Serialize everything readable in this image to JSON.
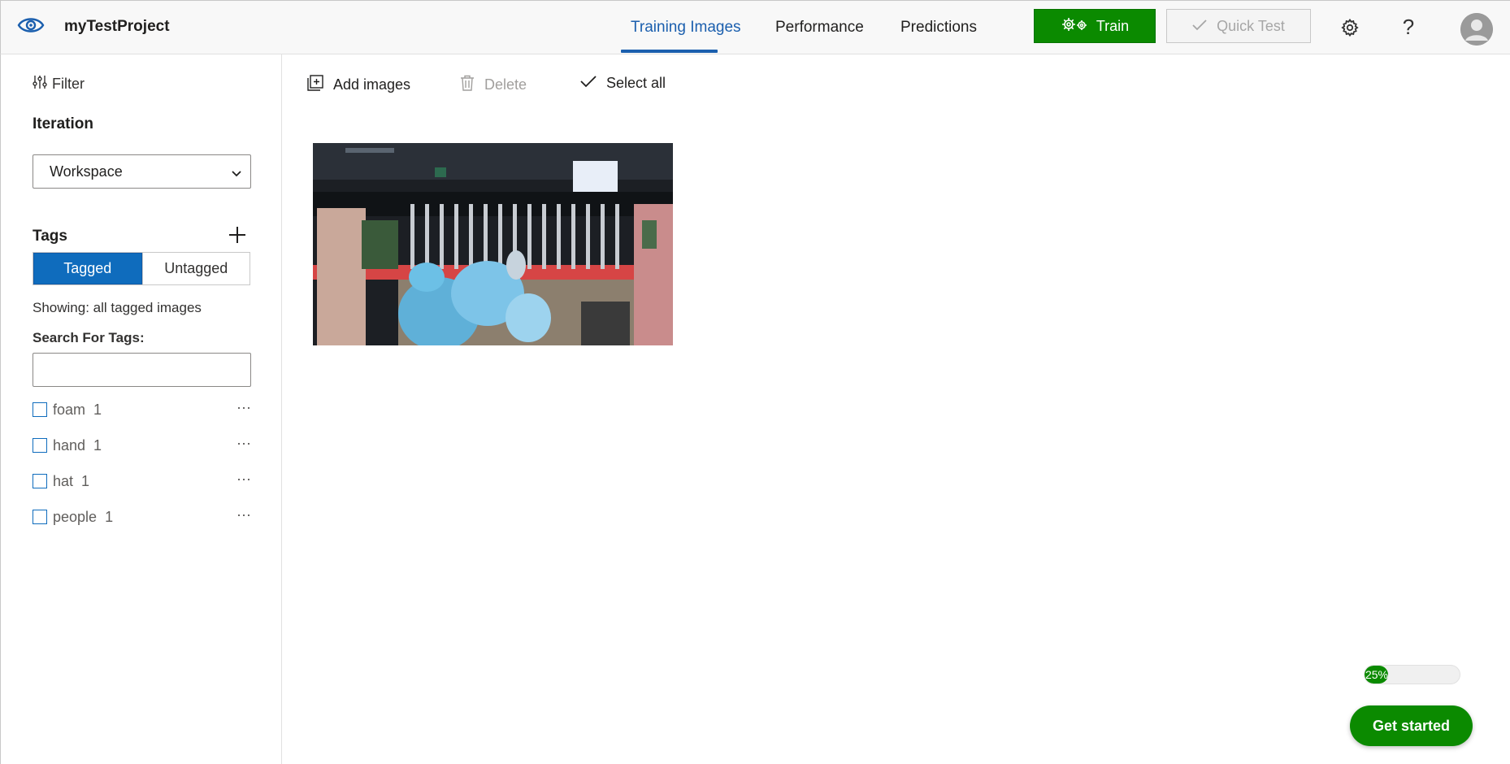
{
  "app": {
    "project_title": "myTestProject"
  },
  "nav": {
    "tabs": [
      {
        "label": "Training Images",
        "active": true
      },
      {
        "label": "Performance",
        "active": false
      },
      {
        "label": "Predictions",
        "active": false
      }
    ],
    "train_label": "Train",
    "quick_test_label": "Quick Test",
    "help_label": "?"
  },
  "sidebar": {
    "filter_label": "Filter",
    "iteration_label": "Iteration",
    "iteration_selected": "Workspace",
    "tags_label": "Tags",
    "segment": {
      "tagged": "Tagged",
      "untagged": "Untagged",
      "selected": "Tagged"
    },
    "showing_text": "Showing: all tagged images",
    "search_label": "Search For Tags:",
    "search_value": "",
    "tags": [
      {
        "name": "foam",
        "count": "1"
      },
      {
        "name": "hand",
        "count": "1"
      },
      {
        "name": "hat",
        "count": "1"
      },
      {
        "name": "people",
        "count": "1"
      }
    ]
  },
  "toolbar": {
    "add_images": "Add images",
    "delete": "Delete",
    "select_all": "Select all"
  },
  "images": {
    "count_shown": 1
  },
  "onboarding": {
    "progress_percent": 25,
    "progress_text": "25%",
    "get_started_label": "Get started"
  },
  "colors": {
    "accent_blue": "#0f6cbd",
    "train_green": "#0b8a00",
    "nav_active": "#1b5fae"
  }
}
